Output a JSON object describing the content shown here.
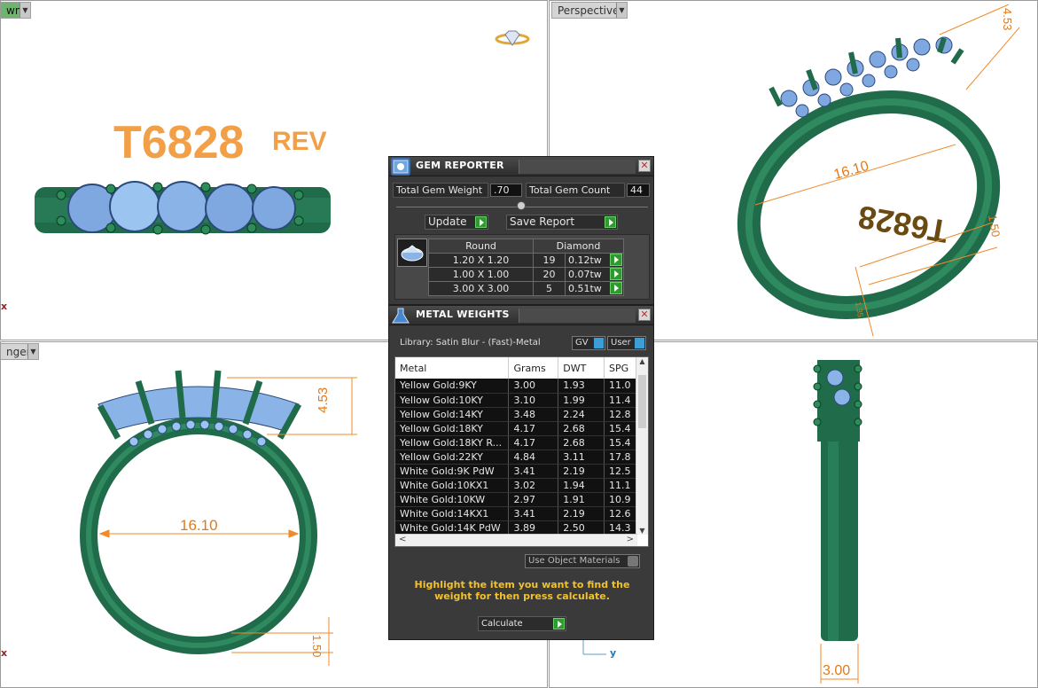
{
  "viewports": {
    "top": {
      "label": "wn",
      "axis": "x"
    },
    "perspective": {
      "label": "Perspective"
    },
    "front": {
      "label": "nger",
      "axis": "x"
    },
    "right": {
      "axis": "y"
    }
  },
  "model": {
    "code": "T6828",
    "rev": "REV",
    "engraving": "T6828",
    "dims": {
      "height": "4.53",
      "width": "16.10",
      "thickness": "1.50",
      "band": "3.00",
      "persp_small": "1.35"
    }
  },
  "colors": {
    "metal": "#1f6b4a",
    "gem": "#8ab4e8",
    "dimension": "#f08a2a",
    "hint": "#f2c12e"
  },
  "gem_reporter": {
    "title": "GEM REPORTER",
    "total_weight_label": "Total Gem Weight",
    "total_weight_value": ".70",
    "total_count_label": "Total Gem Count",
    "total_count_value": "44",
    "update_label": "Update",
    "save_label": "Save Report",
    "shape": "Round",
    "type": "Diamond",
    "rows": [
      {
        "size": "1.20 X 1.20",
        "count": "19",
        "weight": "0.12tw"
      },
      {
        "size": "1.00 X 1.00",
        "count": "20",
        "weight": "0.07tw"
      },
      {
        "size": "3.00 X 3.00",
        "count": "5",
        "weight": "0.51tw"
      }
    ]
  },
  "metal_weights": {
    "title": "METAL WEIGHTS",
    "library": "Library: Satin Blur - (Fast)-Metal",
    "gv_label": "GV",
    "user_label": "User",
    "columns": [
      "Metal",
      "Grams",
      "DWT",
      "SPG"
    ],
    "rows": [
      [
        "Yellow Gold:9KY",
        "3.00",
        "1.93",
        "11.0"
      ],
      [
        "Yellow Gold:10KY",
        "3.10",
        "1.99",
        "11.4"
      ],
      [
        "Yellow Gold:14KY",
        "3.48",
        "2.24",
        "12.8"
      ],
      [
        "Yellow Gold:18KY",
        "4.17",
        "2.68",
        "15.4"
      ],
      [
        "Yellow Gold:18KY R...",
        "4.17",
        "2.68",
        "15.4"
      ],
      [
        "Yellow Gold:22KY",
        "4.84",
        "3.11",
        "17.8"
      ],
      [
        "White Gold:9K PdW",
        "3.41",
        "2.19",
        "12.5"
      ],
      [
        "White Gold:10KX1",
        "3.02",
        "1.94",
        "11.1"
      ],
      [
        "White Gold:10KW",
        "2.97",
        "1.91",
        "10.9"
      ],
      [
        "White Gold:14KX1",
        "3.41",
        "2.19",
        "12.6"
      ],
      [
        "White Gold:14K PdW",
        "3.89",
        "2.50",
        "14.3"
      ]
    ],
    "use_object_materials": "Use Object Materials",
    "hint": "Highlight the item you want to find the weight for then press calculate.",
    "calculate_label": "Calculate"
  }
}
